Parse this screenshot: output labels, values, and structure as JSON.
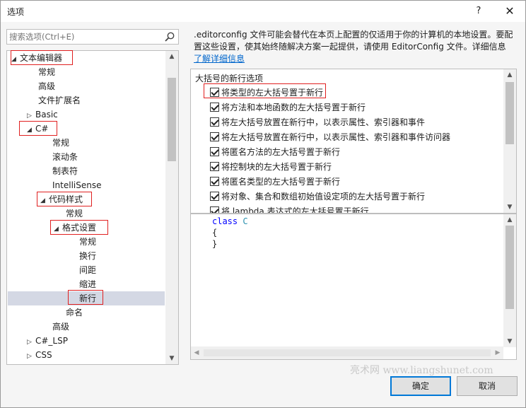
{
  "window": {
    "title": "选项",
    "help_label": "?",
    "close_label": "✕"
  },
  "search": {
    "placeholder": "搜索选项(Ctrl+E)"
  },
  "tree": {
    "items": [
      {
        "label": "文本编辑器",
        "arrow": "◢"
      },
      {
        "label": "常规",
        "arrow": ""
      },
      {
        "label": "高级",
        "arrow": ""
      },
      {
        "label": "文件扩展名",
        "arrow": ""
      },
      {
        "label": "Basic",
        "arrow": "▷"
      },
      {
        "label": "C#",
        "arrow": "◢"
      },
      {
        "label": "常规",
        "arrow": ""
      },
      {
        "label": "滚动条",
        "arrow": ""
      },
      {
        "label": "制表符",
        "arrow": ""
      },
      {
        "label": "IntelliSense",
        "arrow": ""
      },
      {
        "label": "代码样式",
        "arrow": "◢"
      },
      {
        "label": "常规",
        "arrow": ""
      },
      {
        "label": "格式设置",
        "arrow": "◢"
      },
      {
        "label": "常规",
        "arrow": ""
      },
      {
        "label": "换行",
        "arrow": ""
      },
      {
        "label": "间距",
        "arrow": ""
      },
      {
        "label": "缩进",
        "arrow": ""
      },
      {
        "label": "新行",
        "arrow": ""
      },
      {
        "label": "命名",
        "arrow": ""
      },
      {
        "label": "高级",
        "arrow": ""
      },
      {
        "label": "C#_LSP",
        "arrow": "▷"
      },
      {
        "label": "CSS",
        "arrow": "▷"
      }
    ],
    "selected": "新行"
  },
  "description": {
    "text": ".editorconfig 文件可能会替代在本页上配置的仅适用于你的计算机的本地设置。要配置这些设置，使其始终随解决方案一起提供，请使用 EditorConfig 文件。详细信息",
    "link": "了解详细信息"
  },
  "options": {
    "group_label": "大括号的新行选项",
    "items": [
      {
        "label": "将类型的左大括号置于新行",
        "checked": true
      },
      {
        "label": "将方法和本地函数的左大括号置于新行",
        "checked": true
      },
      {
        "label": "将左大括号放置在新行中，以表示属性、索引器和事件",
        "checked": true
      },
      {
        "label": "将左大括号放置在新行中，以表示属性、索引器和事件访问器",
        "checked": true
      },
      {
        "label": "将匿名方法的左大括号置于新行",
        "checked": true
      },
      {
        "label": "将控制块的左大括号置于新行",
        "checked": true
      },
      {
        "label": "将匿名类型的左大括号置于新行",
        "checked": true
      },
      {
        "label": "将对象、集合和数组初始值设定项的左大括号置于新行",
        "checked": true
      },
      {
        "label": "将 lambda 表达式的左大括号置于新行",
        "checked": true
      }
    ]
  },
  "preview": {
    "line1_kw": "class",
    "line1_name": "C",
    "line2": "{",
    "line3": "}"
  },
  "watermark": "亮术网 www.liangshunet.com",
  "buttons": {
    "ok": "确定",
    "cancel": "取消"
  }
}
